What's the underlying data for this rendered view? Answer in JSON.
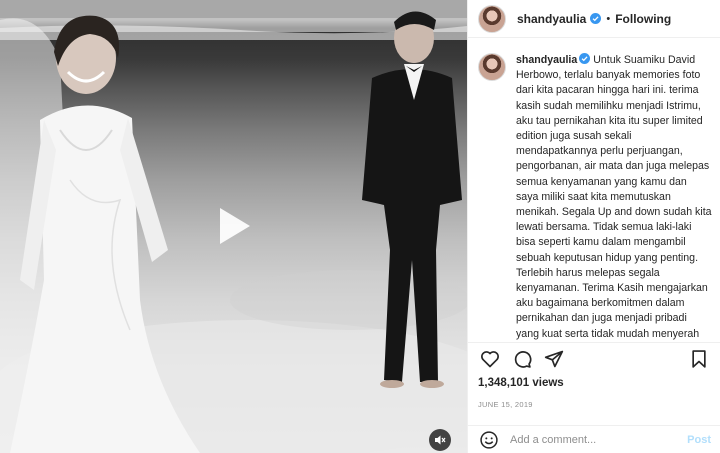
{
  "post": {
    "username": "shandyaulia",
    "verified": true,
    "separator": "•",
    "follow_state": "Following",
    "caption_text": "Untuk Suamiku David Herbowo, terlalu banyak memories foto dari kita pacaran hingga hari ini. terima kasih sudah memilihku menjadi Istrimu, aku tau pernikahan kita itu super limited edition juga susah sekali mendapatkannya perlu perjuangan, pengorbanan, air mata dan juga melepas semua kenyamanan yang kamu dan saya miliki saat kita memutuskan menikah. Segala Up and down sudah kita lewati bersama. Tidak semua laki-laki bisa seperti kamu dalam mengambil sebuah keputusan hidup yang penting. Terlebih harus melepas segala kenyamanan. Terima Kasih mengajarkan aku bagaimana berkomitmen dalam pernikahan dan juga menjadi pribadi yang kuat serta tidak mudah menyerah dalam segala aspek kehidupanku. Aku",
    "views": "1,348,101 views",
    "date": "JUNE 15, 2019"
  },
  "comment": {
    "placeholder": "Add a comment...",
    "post_label": "Post"
  },
  "icons": {
    "like": "heart-icon",
    "comment": "comment-icon",
    "share": "paper-plane-icon",
    "save": "bookmark-icon",
    "emoji": "smiley-icon",
    "play": "play-icon",
    "mute": "speaker-muted-icon"
  },
  "colors": {
    "verified": "#3897f0",
    "post_button": "#b2dffc",
    "muted_text": "#8e8e8e"
  }
}
